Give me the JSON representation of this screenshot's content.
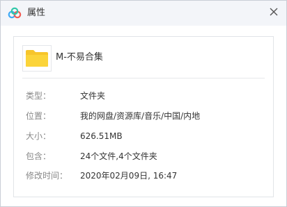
{
  "window": {
    "title": "属性",
    "app_icon": "baidu-netdisk-cloud-icon",
    "close_icon": "close-icon"
  },
  "item": {
    "name": "M-不易合集",
    "icon": "folder-icon",
    "folder_color": "#f7c52b"
  },
  "properties": [
    {
      "label": "类型：",
      "value": "文件夹"
    },
    {
      "label": "位置：",
      "value": "我的网盘/资源库/音乐/中国/内地"
    },
    {
      "label": "大小：",
      "value": "626.51MB"
    },
    {
      "label": "包含：",
      "value": "24个文件,4个文件夹"
    },
    {
      "label": "修改时间：",
      "value": "2020年02月09日, 16:47"
    }
  ]
}
